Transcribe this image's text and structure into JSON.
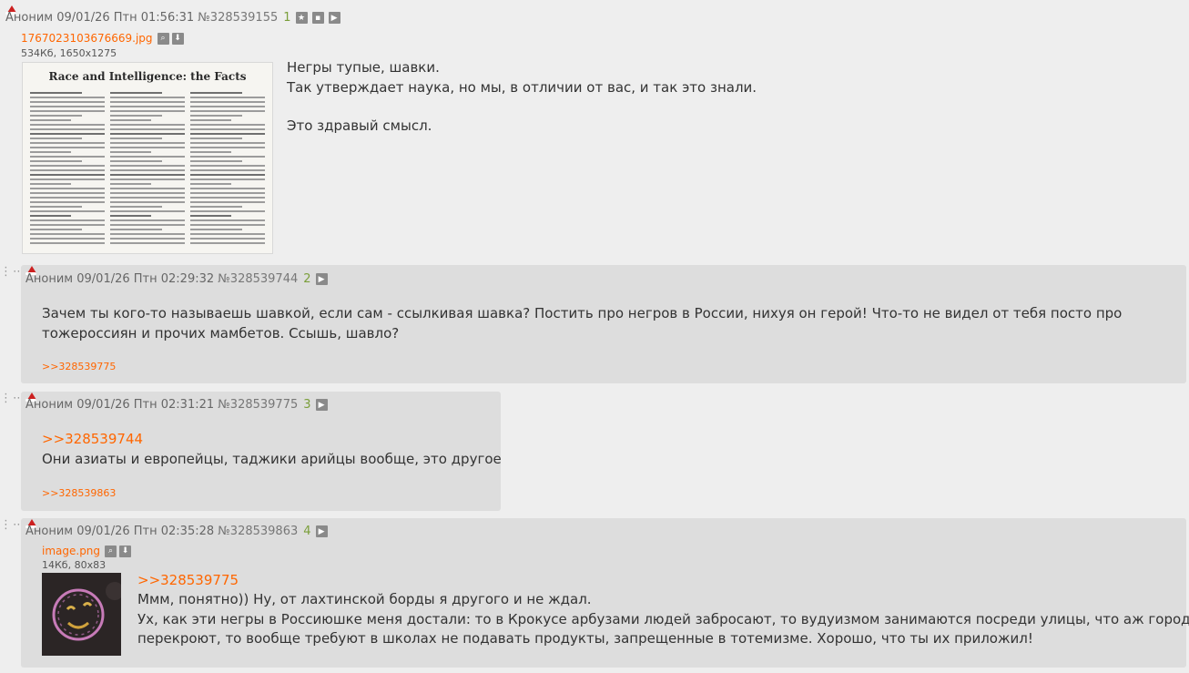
{
  "op": {
    "name": "Аноним",
    "date": "09/01/26 Птн 01:56:31",
    "num": "№328539155",
    "count": "1",
    "file": {
      "name": "1767023103676669.jpg",
      "meta": "534Кб, 1650x1275",
      "thumb_title": "Race and Intelligence: the Facts"
    },
    "lines": [
      "Негры тупые, шавки.",
      "Так утверждает наука, но мы, в отличии от вас, и так это знали.",
      "",
      "Это здравый смысл."
    ]
  },
  "replies": [
    {
      "name": "Аноним",
      "date": "09/01/26 Птн 02:29:32",
      "num": "№328539744",
      "count": "2",
      "lines": [
        "Зачем ты кого-то называешь шавкой, если сам - ссылкивая шавка? Постить про негров в России, нихуя он герой! Что-то не видел от тебя посто про",
        "тожероссиян и прочих мамбетов. Ссышь, шавло?"
      ],
      "backlink": ">>328539775"
    },
    {
      "name": "Аноним",
      "date": "09/01/26 Птн 02:31:21",
      "num": "№328539775",
      "count": "3",
      "quote": ">>328539744",
      "lines": [
        "Они азиаты и европейцы, таджики арийцы вообще, это другое"
      ],
      "backlink": ">>328539863"
    },
    {
      "name": "Аноним",
      "date": "09/01/26 Птн 02:35:28",
      "num": "№328539863",
      "count": "4",
      "file": {
        "name": "image.png",
        "meta": "14Кб, 80x83"
      },
      "quote": ">>328539775",
      "lines": [
        "Ммм, понятно)) Ну, от лахтинской борды я другого и не ждал.",
        "Ух, как эти негры в Россиюшке меня достали: то в Крокусе арбузами людей забросают, то вудуизмом занимаются посреди улицы, что аж город",
        "перекроют, то вообще требуют в школах не подавать продукты, запрещенные в тотемизме. Хорошо, что ты их приложил!"
      ]
    }
  ],
  "colors": {
    "link": "#ff6600",
    "reply_bg": "#dddddd",
    "page_bg": "#eeeeee",
    "post_count": "#7a9e3a"
  },
  "icons": {
    "star": "star-icon",
    "expand": "expand-icon",
    "play": "play-icon",
    "search": "search-icon",
    "download": "download-icon",
    "hat": "santa-hat-icon"
  }
}
